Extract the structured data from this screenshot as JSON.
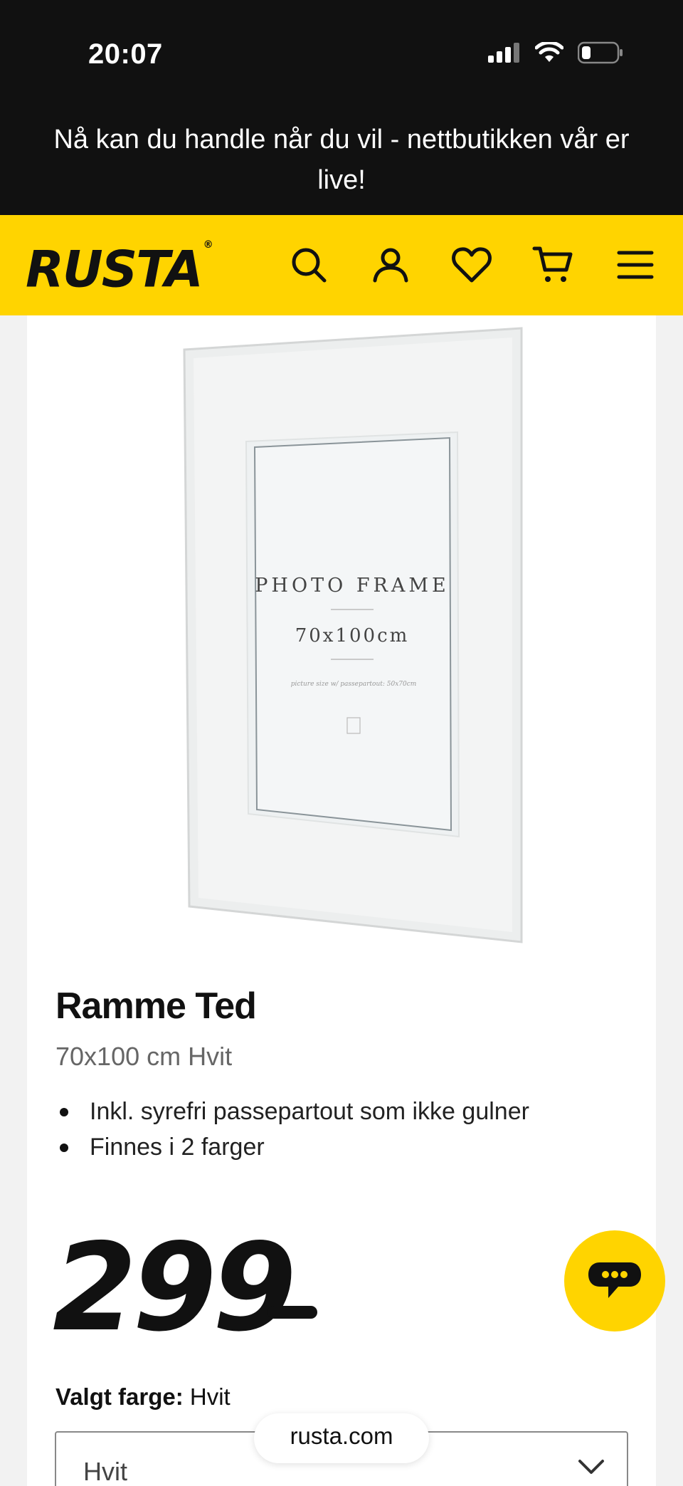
{
  "status_bar": {
    "time": "20:07"
  },
  "announcement": {
    "text": "Nå kan du handle når du vil - nettbutikken vår er live!"
  },
  "header": {
    "logo": "RUSTA",
    "logo_mark": "®",
    "icons": [
      "search-icon",
      "account-icon",
      "heart-icon",
      "cart-icon",
      "menu-icon"
    ]
  },
  "product": {
    "image_text": {
      "line1": "PHOTO FRAME",
      "line2": "70x100cm",
      "line3": "picture size w/ passepartout: 50x70cm"
    },
    "title": "Ramme Ted",
    "subtitle": "70x100 cm Hvit",
    "features": [
      "Inkl. syrefri passepartout som ikke gulner",
      "Finnes i 2 farger"
    ],
    "price": "299",
    "color_label": "Valgt farge:",
    "color_value": "Hvit",
    "select_value": "Hvit"
  },
  "url_bar": {
    "domain": "rusta.com"
  },
  "colors": {
    "brand_yellow": "#ffd400",
    "dark": "#111111"
  }
}
